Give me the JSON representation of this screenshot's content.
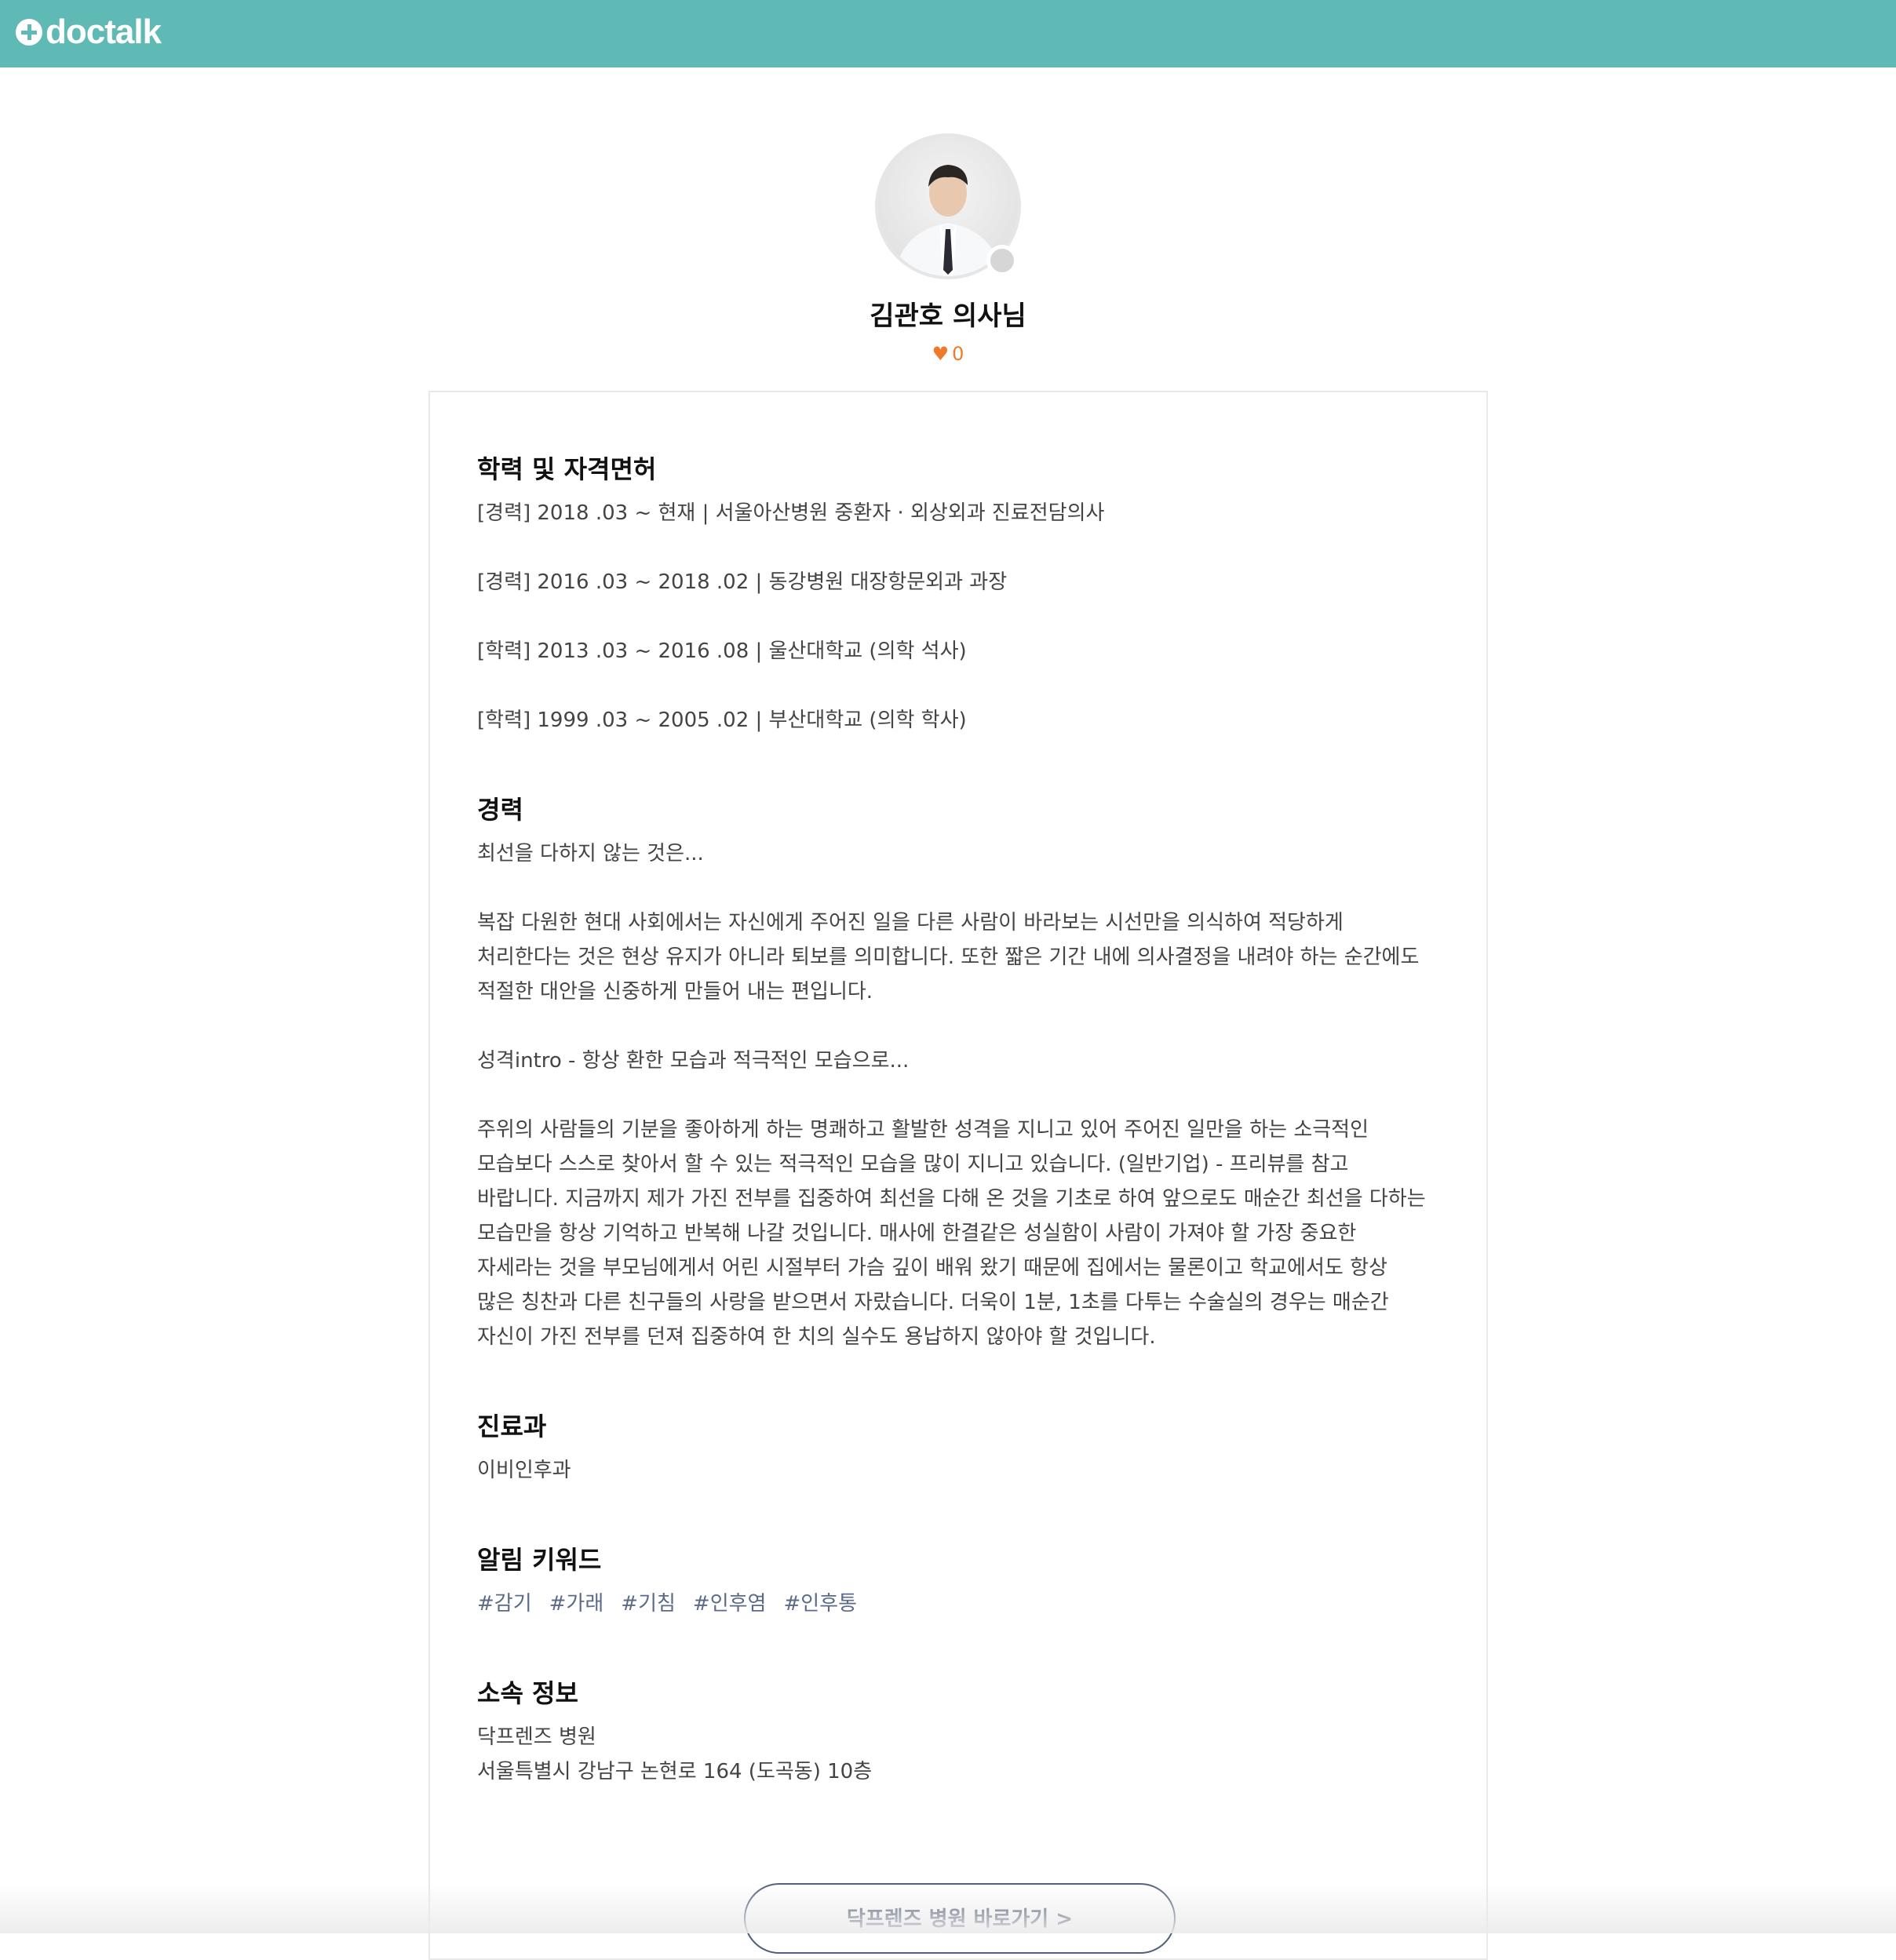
{
  "header": {
    "logo_text": "doctalk",
    "brand_color": "#5fb9b4"
  },
  "profile": {
    "name": "김관호 의사님",
    "likes_count": "0",
    "heart_icon": "heart-icon",
    "accent_color": "#ee7a2c"
  },
  "sections": {
    "education": {
      "title": "학력 및 자격면허",
      "lines": [
        "[경력] 2018 .03 ~ 현재 | 서울아산병원 중환자 · 외상외과 진료전담의사",
        "[경력] 2016 .03 ~ 2018 .02 | 동강병원 대장항문외과 과장",
        "[학력] 2013 .03 ~ 2016 .08 | 울산대학교 (의학 석사)",
        "[학력] 1999 .03 ~ 2005 .02 | 부산대학교 (의학 학사)"
      ]
    },
    "career": {
      "title": "경력",
      "p1": "최선을 다하지 않는 것은...",
      "p2": [
        "복잡 다원한 현대 사회에서는 자신에게 주어진 일을 다른 사람이 바라보는 시선만을 의식하여 적당하게",
        "처리한다는 것은 현상 유지가 아니라 퇴보를 의미합니다. 또한 짧은 기간 내에 의사결정을 내려야 하는 순간에도",
        "적절한 대안을 신중하게 만들어 내는 편입니다."
      ],
      "p3": "성격intro - 항상 환한 모습과 적극적인 모습으로...",
      "p4": [
        "주위의 사람들의 기분을 좋아하게 하는 명쾌하고 활발한 성격을 지니고 있어 주어진 일만을 하는 소극적인",
        "모습보다 스스로 찾아서 할 수 있는 적극적인 모습을 많이 지니고 있습니다. (일반기업) - 프리뷰를 참고",
        "바랍니다. 지금까지 제가 가진 전부를 집중하여 최선을 다해 온 것을 기초로 하여 앞으로도 매순간 최선을 다하는",
        "모습만을 항상 기억하고 반복해 나갈 것입니다. 매사에 한결같은 성실함이 사람이 가져야 할 가장 중요한",
        "자세라는 것을 부모님에게서 어린 시절부터 가슴 깊이 배워 왔기 때문에 집에서는 물론이고 학교에서도 항상",
        "많은 칭찬과 다른 친구들의 사랑을 받으면서 자랐습니다. 더욱이 1분, 1초를 다투는 수술실의 경우는 매순간",
        "자신이 가진 전부를 던져 집중하여 한 치의 실수도 용납하지 않아야 할 것입니다."
      ]
    },
    "department": {
      "title": "진료과",
      "value": "이비인후과"
    },
    "keywords": {
      "title": "알림 키워드",
      "tags": [
        "#감기",
        "#가래",
        "#기침",
        "#인후염",
        "#인후통"
      ]
    },
    "affiliation": {
      "title": "소속 정보",
      "hospital": "닥프렌즈 병원",
      "address": "서울특별시 강남구 논현로 164 (도곡동) 10층"
    }
  },
  "actions": {
    "hospital_button": "닥프렌즈 병원 바로가기 >"
  }
}
